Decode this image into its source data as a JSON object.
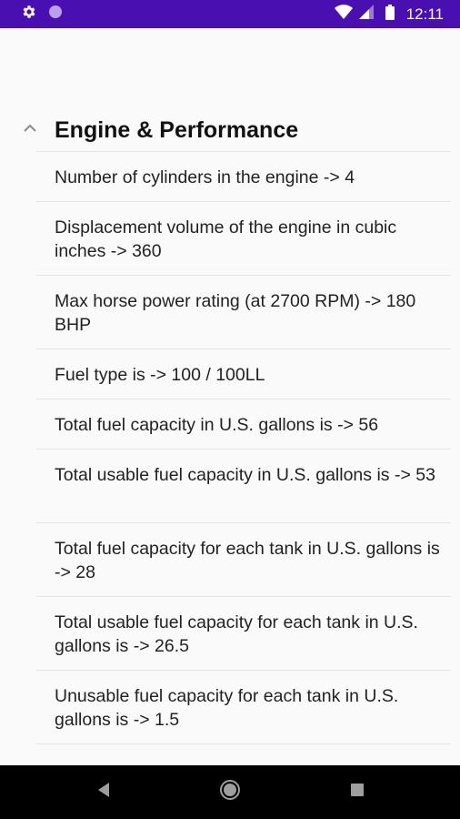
{
  "status_bar": {
    "time": "12:11",
    "icons": [
      "gear-icon",
      "circle-icon",
      "wifi-icon",
      "signal-icon",
      "battery-icon"
    ]
  },
  "section": {
    "title": "Engine & Performance",
    "expanded": true
  },
  "items": [
    "Number of cylinders in the engine -> 4",
    "Displacement volume of the engine in cubic inches  -> 360",
    "Max horse power rating (at 2700 RPM)  -> 180 BHP",
    "Fuel type is -> 100 / 100LL",
    "Total fuel capacity in U.S. gallons is -> 56",
    "Total usable fuel capacity in U.S. gallons is -> 53",
    "Total fuel capacity for each tank in U.S. gallons is -> 28",
    "Total usable fuel capacity for each tank in U.S. gallons is -> 26.5",
    "Unusable fuel capacity for each tank in U.S. gallons is -> 1.5"
  ],
  "nav_bar": {
    "buttons": [
      "back-icon",
      "home-icon",
      "recents-icon"
    ]
  }
}
